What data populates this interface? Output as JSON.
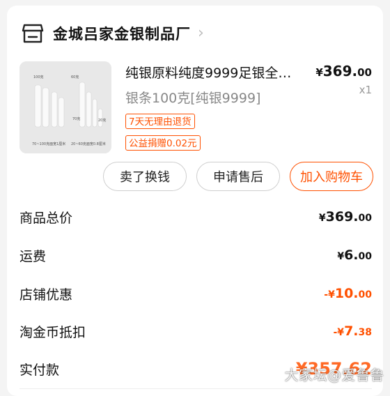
{
  "shop": {
    "name": "金城吕家金银制品厂",
    "icon": "store-icon"
  },
  "product": {
    "title": "纯银原料纯度9999足银全…",
    "sku": "银条100克[纯银9999]",
    "price_currency": "¥",
    "price_int": "369.",
    "price_dec": "00",
    "quantity": "x1",
    "tags": [
      "7天无理由退货",
      "公益捐赠0.02元"
    ],
    "image_labels": [
      "100克",
      "60克",
      "70克",
      "20克",
      "70~100克面宽1厘米",
      "20~60克面宽0.8厘米"
    ]
  },
  "actions": {
    "sell": "卖了换钱",
    "after_sale": "申请售后",
    "add_cart": "加入购物车"
  },
  "summary": {
    "total_label": "商品总价",
    "total_cur": "¥",
    "total_int": "369.",
    "total_dec": "00",
    "shipping_label": "运费",
    "shipping_cur": "¥",
    "shipping_int": "6.",
    "shipping_dec": "00",
    "discount_label": "店铺优惠",
    "discount_cur": "-¥",
    "discount_int": "10.",
    "discount_dec": "00",
    "coin_label": "淘金币抵扣",
    "coin_cur": "-¥",
    "coin_int": "7.",
    "coin_dec": "38",
    "paid_label": "实付款",
    "paid_value": "¥357.62"
  },
  "watermark": "大家坛@爱鲁鲁",
  "colors": {
    "accent": "#ff5000"
  }
}
